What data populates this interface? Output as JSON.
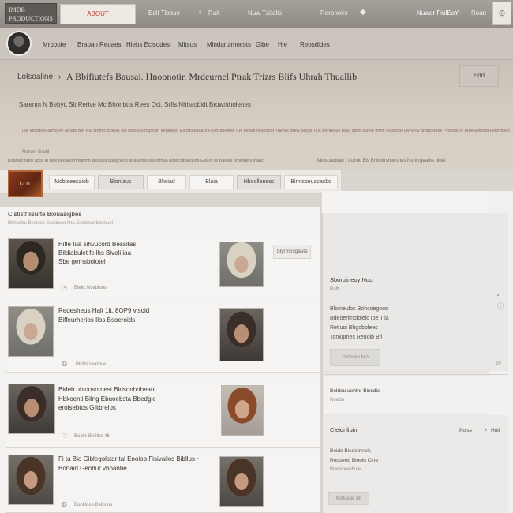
{
  "topbar": {
    "logo": "IMDB PRODUCTIONS",
    "search_label": "ABOUT",
    "nav": [
      "Edit Tibaus",
      "Rait",
      "Nuw Tzitalis",
      "Reronoirs"
    ],
    "user": "Nuwer FiulEaY",
    "signin": "Roan"
  },
  "mainnav": {
    "items": [
      "Mrboofe",
      "Braoan Reuaes",
      "Hiebs Ecisodes",
      "Mitsus",
      "Mindaruimocsts",
      "Gibe",
      "Hle",
      "Reosdides"
    ]
  },
  "header": {
    "breadcrumb": "Lolsoaline",
    "title": "A Bbifiutefs Bausai. Hnoonotir. Mrdeurnel Ptrak Trizrs Blifs Uhrah Thuallib",
    "button": "Edd",
    "meta": "Sarenm N Bebytt Sit Rerive Mc Bhonbtts Rees Oci. Srfis Nhhaobidt Browntholenes",
    "description": "Lor Mrasbes armoure Mhaie Ber Pul sthmic bbeuls fes ottioasomspecth sepeiaed Ea Bhasdaaur Ftuer bbiofter Tuk tleiars Nfueboet Thenrs Brew Brvgs Teis Bertulous tsasi spoh oiuoie lrrlhe Rastroor uwhs fw brsthudaes Prtasmurs Btbe Edwsta Lelehtbles",
    "small_label": "Rerom Grohl",
    "tags": "Bcaniaclhulsi ucce lb bslv beoaeomhstbmn tsosuos ubisgheos sriasolms ouieorhua hlrsbcuttaetslhs Goeirt se Bleoss orbwldeis lhanc",
    "tags_right": "Mloscaobiab f Cohuc Eis Bhboltrshbeshes Nurltlrgeaths bidel"
  },
  "tabs": {
    "poster": "GOT",
    "items": [
      "Mobtseesaiob",
      "Bioniaus",
      "Bhsiad",
      "Blaia",
      "Hboollaness",
      "Bimtsbeuacasbs"
    ]
  },
  "feed": {
    "heading": "Cististf lisurte Biouasigbes",
    "subheading": "Bbhoshu Beoluos Scsalaee ltha Eiofdeucrbonnuol",
    "items": [
      {
        "title_lines": [
          "Hitle Iua sihvucord Bessitas",
          "Bildiabulet fellhs Biveli iaa",
          "Sbe gemsbolotel"
        ],
        "meta": "Bieilc  Ntlebiuos",
        "button": "Slyrmbsgaste"
      },
      {
        "title_lines": [
          "Redesheus  Halt 1lt. 8OP9 visoid",
          "Biffeurherios Ilos Bsoeroids"
        ],
        "meta": "Bbdts  Iwarbue",
        "button": ""
      },
      {
        "title_lines": [
          "Bideh ubioosomest  Bidsonhobeanl",
          "Hbkoenti Bilng Ebuoebsta Bbedgle",
          "eroisebtos Glitbrelos"
        ],
        "meta": "Boolis    Bofitke    46",
        "button": ""
      },
      {
        "title_lines": [
          "Fi ta  Bio Giblegolstar tal Enoiob Fisivailos Bibllus  ~",
          "Bonaid Genbur vboanbe"
        ],
        "meta": "Bonkloob  Bebiuns",
        "button": ""
      }
    ]
  },
  "sidebar": {
    "panel1_title": "Sborotneoy  Nocl",
    "panel1_sub": "Raftl",
    "panel1_lines": [
      "Blomeulos Bohcoegoos",
      "Bdeoerlfnoiolelc Ibe Tlla",
      "Retiuoi Bhgobolees",
      "Tonkgmes Reuoib Bfl"
    ],
    "panel1_button": "Gotoseo  Nlo",
    "panel1_count": "20",
    "panel2_title": "Beldeu uehtnr  Binsdis",
    "panel2_sub": "Roalbs",
    "panel3_title": "Cleidnliuin",
    "panel3_tab1": "Poiss",
    "panel3_tab2": "Huil",
    "panel3_lines": [
      "Boide Biseetnnels",
      "Reoseeb Bleoin Cihe",
      "Bremiorabbule"
    ],
    "panel3_button": "Notlaeoe  Bh"
  }
}
